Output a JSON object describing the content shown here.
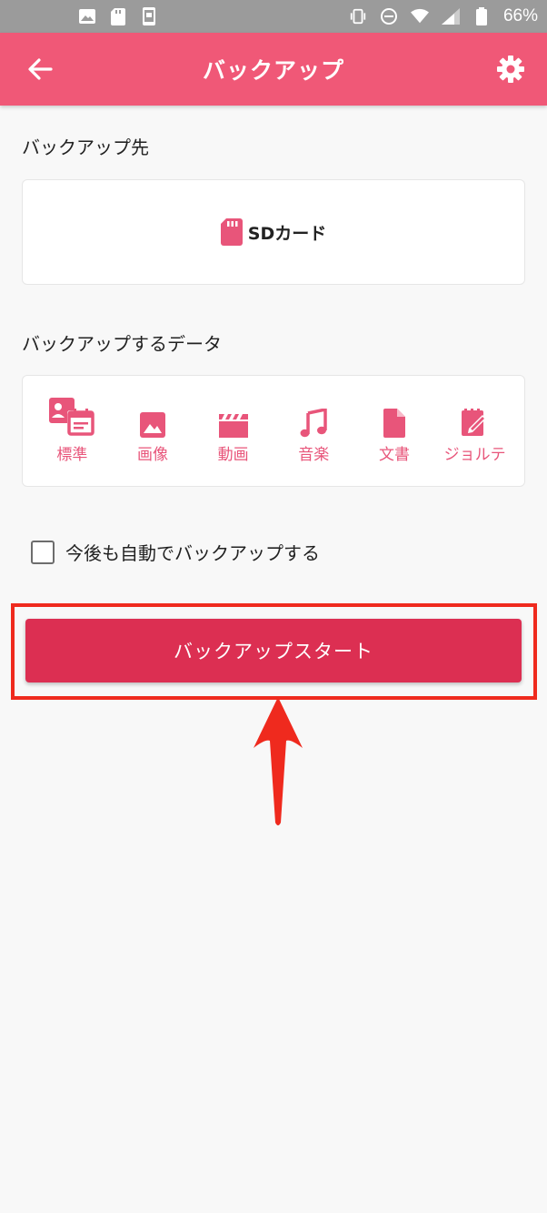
{
  "status_bar": {
    "battery_text": "66%",
    "icons": [
      "image-icon",
      "sd-card-icon",
      "phone-icon",
      "vibrate-icon",
      "dnd-icon",
      "wifi-icon",
      "signal-icon",
      "battery-icon"
    ]
  },
  "app_bar": {
    "title": "バックアップ",
    "back_icon": "arrow-left-icon",
    "settings_icon": "gear-icon"
  },
  "destination": {
    "label": "バックアップ先",
    "value": "SDカード",
    "icon": "sd-card-icon"
  },
  "data_section": {
    "label": "バックアップするデータ",
    "items": [
      {
        "label": "標準",
        "icon": "contacts-calendar-icon"
      },
      {
        "label": "画像",
        "icon": "image-icon"
      },
      {
        "label": "動画",
        "icon": "clapperboard-icon"
      },
      {
        "label": "音楽",
        "icon": "music-note-icon"
      },
      {
        "label": "文書",
        "icon": "document-icon"
      },
      {
        "label": "ジョルテ",
        "icon": "note-edit-icon"
      }
    ]
  },
  "auto_backup": {
    "label": "今後も自動でバックアップする",
    "checked": false
  },
  "start_button": {
    "label": "バックアップスタート"
  },
  "colors": {
    "app_bar": "#f05877",
    "accent_icon": "#e8557a",
    "start_button": "#dc2f52",
    "highlight": "#ef2a1e"
  }
}
